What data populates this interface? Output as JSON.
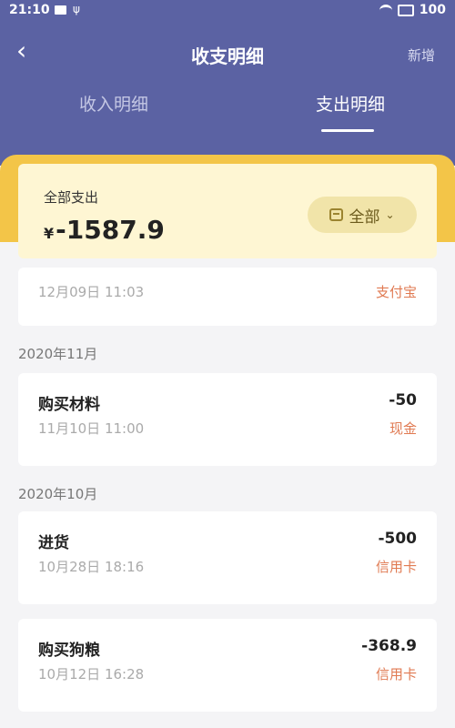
{
  "status_bar": {
    "time": "21:10",
    "battery": "100"
  },
  "nav": {
    "back_icon": "‹",
    "title": "收支明细",
    "add_label": "新增"
  },
  "tabs": {
    "income": "收入明细",
    "expense": "支出明细"
  },
  "summary": {
    "label": "全部支出",
    "currency": "¥",
    "amount": "-1587.9",
    "filter_label": "全部"
  },
  "partial_item": {
    "date": "12月09日 11:03",
    "payment": "支付宝"
  },
  "groups": [
    {
      "month": "2020年11月",
      "items": [
        {
          "name": "购买材料",
          "amount": "-50",
          "date": "11月10日 11:00",
          "payment": "现金"
        }
      ]
    },
    {
      "month": "2020年10月",
      "items": [
        {
          "name": "进货",
          "amount": "-500",
          "date": "10月28日 18:16",
          "payment": "信用卡"
        },
        {
          "name": "购买狗粮",
          "amount": "-368.9",
          "date": "10月12日 16:28",
          "payment": "信用卡"
        }
      ]
    }
  ],
  "colors": {
    "header": "#5b62a3",
    "accent_yellow": "#f3c548",
    "summary_bg": "#fef6d3",
    "payment_text": "#e07a52"
  }
}
